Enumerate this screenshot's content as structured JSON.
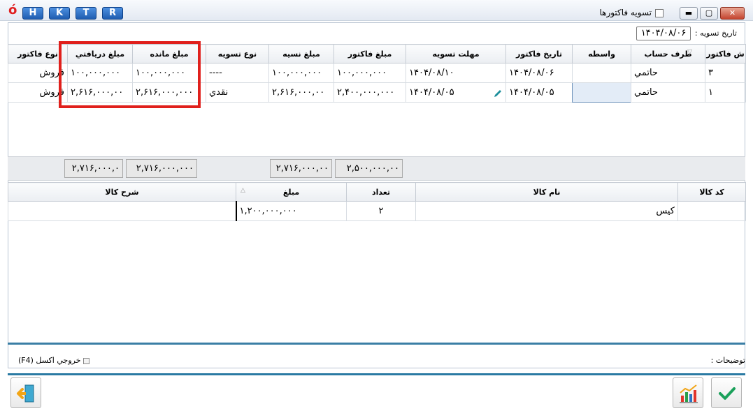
{
  "window": {
    "title": "تسويه فاكتورها",
    "logo": "ó",
    "shortcut_buttons": [
      "H",
      "K",
      "T",
      "R"
    ],
    "min_label": "▬",
    "max_label": "▢",
    "close_label": "✕"
  },
  "header": {
    "date_label": "تاريخ تسويه :",
    "date_value": "۱۴۰۴/۰۸/۰۶"
  },
  "invoice_grid": {
    "columns": [
      "ش فاكتور",
      "طرف حساب",
      "واسطه",
      "تاريخ فاكتور",
      "مهلت تسويه",
      "مبلغ فاكتور",
      "مبلغ نسيه",
      "نوع تسويه",
      "مبلغ مانده",
      "مبلغ دريافتي",
      "نوع فاكتور"
    ],
    "rows": [
      [
        "۳",
        "حاتمي",
        "",
        "۱۴۰۴/۰۸/۰۶",
        "۱۴۰۴/۰۸/۱۰",
        "۱۰۰,۰۰۰,۰۰۰",
        "۱۰۰,۰۰۰,۰۰۰",
        "----",
        "۱۰۰,۰۰۰,۰۰۰",
        "۱۰۰,۰۰۰,۰۰۰",
        "فروش"
      ],
      [
        "۱",
        "حاتمي",
        "",
        "۱۴۰۴/۰۸/۰۵",
        "۱۴۰۴/۰۸/۰۵",
        "۲,۴۰۰,۰۰۰,۰۰۰",
        "۲,۶۱۶,۰۰۰,۰۰",
        "نقدي",
        "۲,۶۱۶,۰۰۰,۰۰۰",
        "۲,۶۱۶,۰۰۰,۰۰",
        "فروش"
      ]
    ]
  },
  "totals": {
    "invoice_amount": "۲,۵۰۰,۰۰۰,۰۰",
    "credit_amount": "۲,۷۱۶,۰۰۰,۰۰",
    "remaining_amount": "۲,۷۱۶,۰۰۰,۰۰۰",
    "received_amount": "۲,۷۱۶,۰۰۰,۰"
  },
  "items_grid": {
    "columns": [
      "كد كالا",
      "نام كالا",
      "تعداد",
      "مبلغ",
      "شرح كالا"
    ],
    "rows": [
      [
        "",
        "كيس",
        "۲",
        "۱,۲۰۰,۰۰۰,۰۰۰",
        ""
      ]
    ]
  },
  "footer": {
    "notes_label": "توضيحات :",
    "excel_label": "خروجي اكسل (F4)"
  },
  "colors": {
    "highlight": "#e0201c",
    "accent": "#2a7aa3",
    "confirm": "#1aa05a"
  }
}
